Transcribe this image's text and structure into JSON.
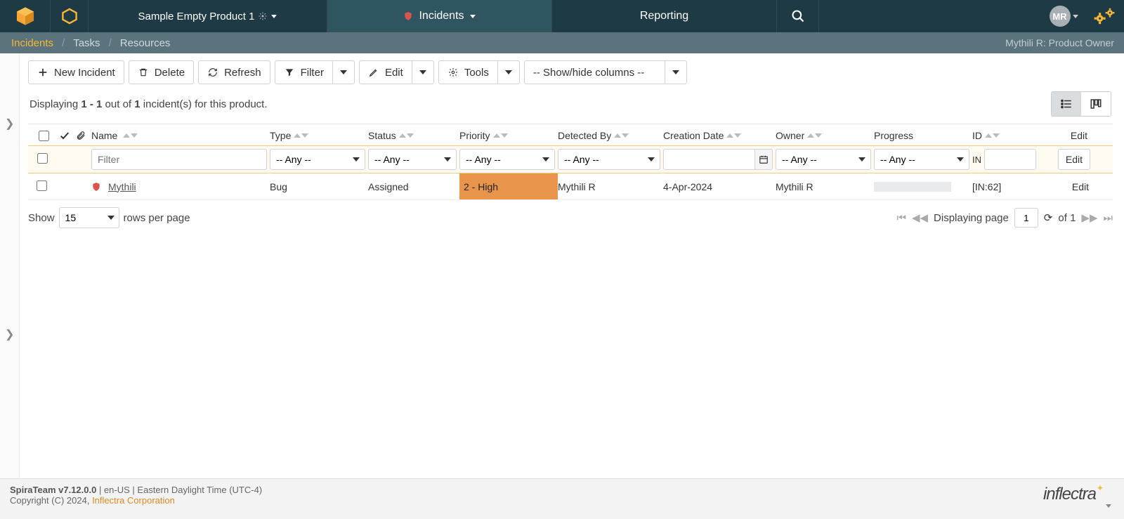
{
  "topnav": {
    "product_label": "Sample Empty Product 1",
    "incidents_label": "Incidents",
    "reporting_label": "Reporting",
    "avatar_initials": "MR"
  },
  "tabs": {
    "incidents": "Incidents",
    "tasks": "Tasks",
    "resources": "Resources",
    "role_label": "Mythili R: Product Owner"
  },
  "toolbar": {
    "new_incident": "New Incident",
    "delete": "Delete",
    "refresh": "Refresh",
    "filter": "Filter",
    "edit": "Edit",
    "tools": "Tools",
    "show_hide": "-- Show/hide columns --"
  },
  "summary": {
    "prefix": "Displaying ",
    "range": "1 - 1",
    "mid": " out of ",
    "total": "1",
    "suffix": " incident(s) for this product."
  },
  "columns": {
    "name": "Name",
    "type": "Type",
    "status": "Status",
    "priority": "Priority",
    "detected_by": "Detected By",
    "creation_date": "Creation Date",
    "owner": "Owner",
    "progress": "Progress",
    "id": "ID",
    "edit": "Edit"
  },
  "filters": {
    "name_placeholder": "Filter",
    "any": "-- Any --",
    "id_prefix": "IN",
    "edit_btn": "Edit"
  },
  "row": {
    "name": "Mythili",
    "type": "Bug",
    "status": "Assigned",
    "priority": "2 - High",
    "detected_by": "Mythili R",
    "creation_date": "4-Apr-2024",
    "owner": "Mythili R",
    "id": "[IN:62]",
    "edit": "Edit"
  },
  "pager": {
    "show": "Show",
    "rows_per_page": "rows per page",
    "page_size": "15",
    "displaying_page": "Displaying page",
    "page_num": "1",
    "of": "of",
    "total_pages": "1"
  },
  "footer": {
    "product_version": "SpiraTeam v7.12.0.0",
    "locale": "en-US",
    "tz": "Eastern Daylight Time (UTC-4)",
    "copyright": "Copyright (C) 2024, ",
    "company": "Inflectra Corporation",
    "logo": "inflectra"
  }
}
